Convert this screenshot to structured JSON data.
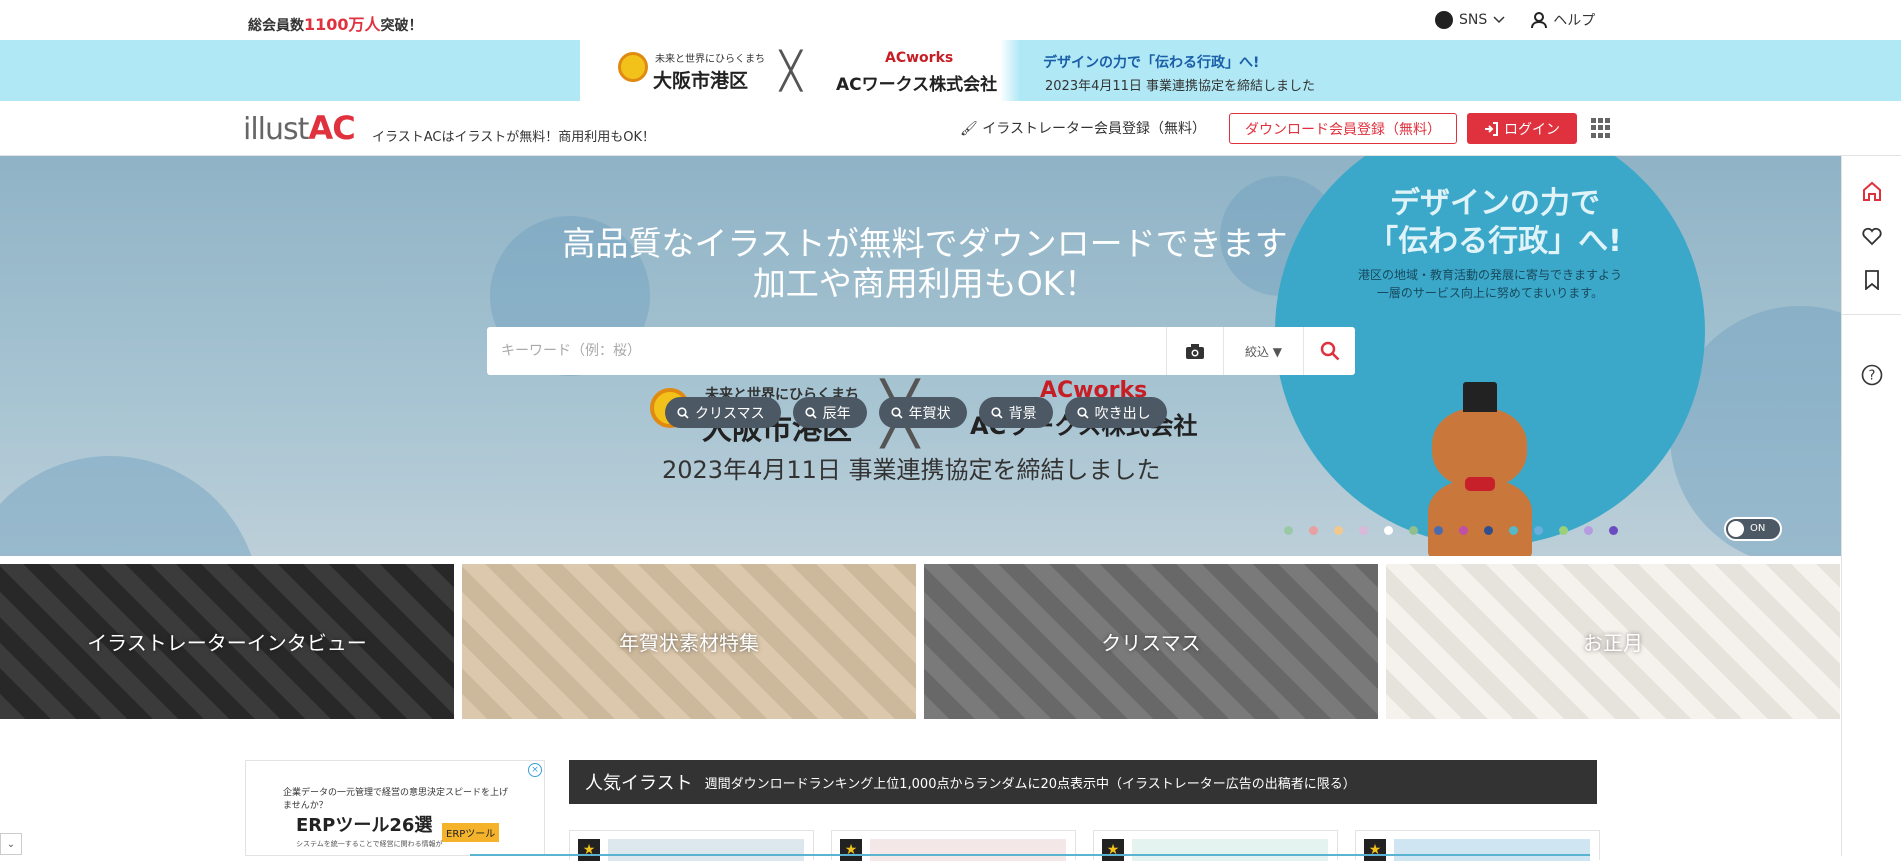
{
  "topbar": {
    "members_prefix": "総会員数",
    "members_count": "1100万人",
    "members_suffix": "突破！",
    "sns_label": "SNS",
    "help_label": "ヘルプ"
  },
  "banner": {
    "org1_tagline": "未来と世界にひらくまち",
    "org1_name": "大阪市港区",
    "org2_logo": "ACworks",
    "org2_name": "ACワークス株式会社",
    "message_1": "デザインの力で「伝わる行政」へ!",
    "message_2": "2023年4月11日 事業連携協定を締結しました"
  },
  "header": {
    "logo_text": "illust",
    "logo_accent": "AC",
    "tagline": "イラストACはイラストが無料！商用利用もOK！",
    "illustrator_register": "イラストレーター会員登録（無料）",
    "download_register": "ダウンロード会員登録（無料）",
    "login": "ログイン"
  },
  "hero": {
    "headline_1": "高品質なイラストが無料でダウンロードできます",
    "headline_2": "加工や商用利用もOK！",
    "bubble_title_1": "デザインの力で",
    "bubble_title_2": "「伝わる行政」へ!",
    "bubble_body_1": "港区の地域・教育活動の発展に寄与できますよう",
    "bubble_body_2": "一層のサービス向上に努めてまいります。",
    "search_placeholder": "キーワード（例：桜）",
    "search_value": "",
    "filter_label": "絞込 ▼",
    "tags": [
      "クリスマス",
      "辰年",
      "年賀状",
      "背景",
      "吹き出し"
    ],
    "collab_date": "2023年4月11日 事業連携協定を締結しました",
    "toggle_label": "ON",
    "slide_dot_colors": [
      "#9bc9a8",
      "#e8a0a0",
      "#f2c88c",
      "#d9b8d9",
      "#ffffff",
      "#8fbf8f",
      "#4b6bb0",
      "#c04fa8",
      "#2f4f8f",
      "#56b8c8",
      "#6aaee0",
      "#9ad07a",
      "#b69ce0",
      "#6a4cc0"
    ]
  },
  "features": [
    {
      "label": "イラストレーターインタビュー",
      "color": "#2a2a2a"
    },
    {
      "label": "年賀状素材特集",
      "color": "#d9c3a5"
    },
    {
      "label": "クリスマス",
      "color": "#6f6f6f"
    },
    {
      "label": "お正月",
      "color": "#f4f0ea"
    }
  ],
  "ad": {
    "line1": "企業データの一元管理で経営の意思決定スピードを上げませんか？",
    "title": "ERPツール26選",
    "badge": "ERPツール",
    "small": "システムを統一することで経営に関わる情報が",
    "close": "×"
  },
  "popular": {
    "title": "人気イラスト",
    "subtitle": "週間ダウンロードランキング上位1,000点からランダムに20点表示中（イラストレーター広告の出稿者に限る）"
  },
  "colors": {
    "brand_red": "#e0313e",
    "banner_bg": "#b0e8f5",
    "tag_bg": "#4c5863"
  }
}
